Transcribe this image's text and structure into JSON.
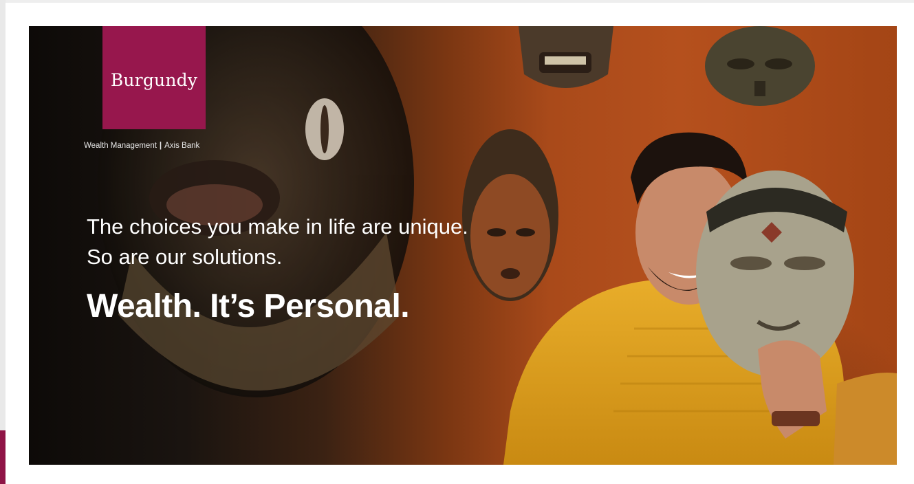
{
  "brand": {
    "logo_text": "Burgundy",
    "division": "Wealth Management",
    "separator": "|",
    "bank": "Axis Bank",
    "color": "#97174d"
  },
  "headline": {
    "line1": "The choices you make in life are unique.",
    "line2": "So are our solutions.",
    "slogan": "Wealth. It’s Personal."
  },
  "visuals": {
    "background_color": "#b5501d",
    "sweater_color": "#e0a11c"
  }
}
